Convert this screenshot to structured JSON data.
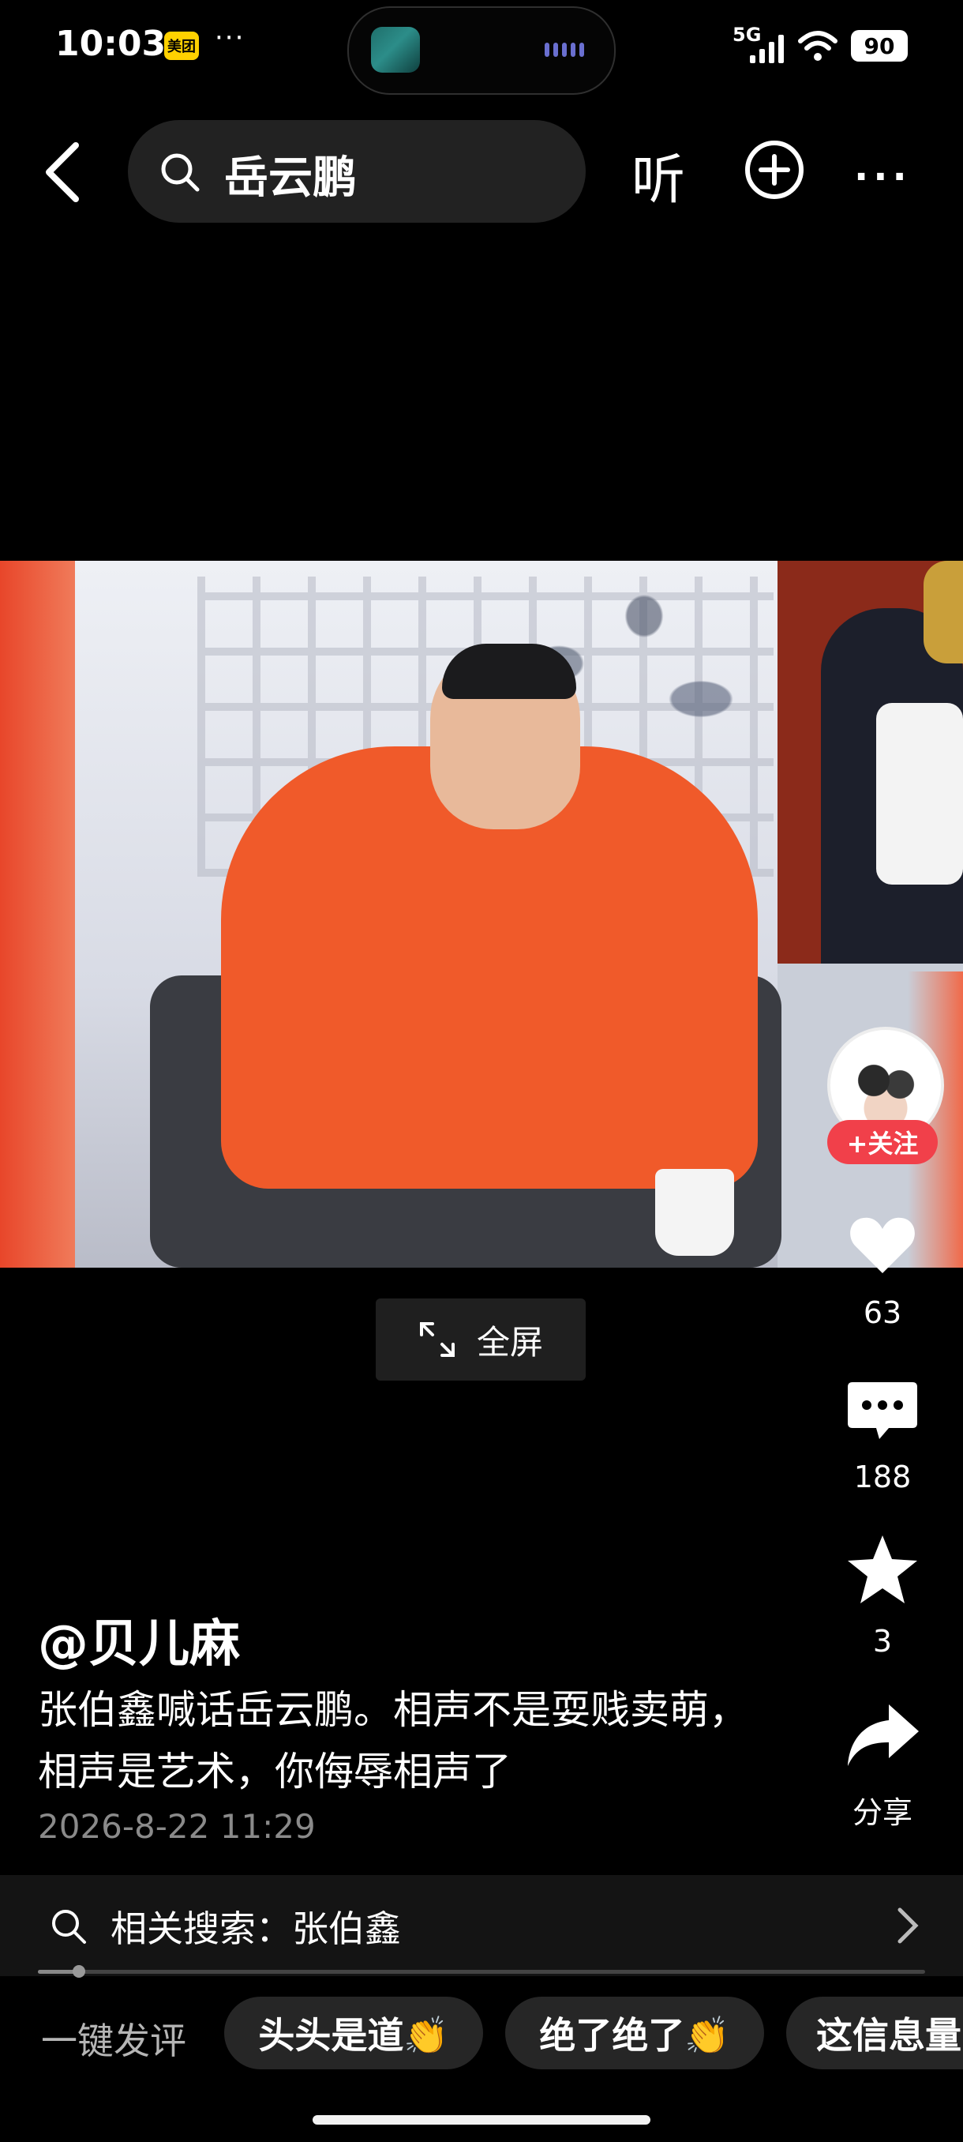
{
  "status_bar": {
    "time": "10:03",
    "app_badge": "美团",
    "more_dots": "···",
    "network": "5G",
    "battery": "90"
  },
  "top_bar": {
    "search_query": "岳云鹏",
    "listen_label": "听"
  },
  "video": {
    "fullscreen_label": "全屏"
  },
  "author_panel": {
    "follow_label": "+关注"
  },
  "actions": {
    "likes": "63",
    "comments": "188",
    "favorites": "3",
    "share_label": "分享"
  },
  "post": {
    "author": "@贝儿麻",
    "caption": "张伯鑫喊话岳云鹏。相声不是耍贱卖萌，相声是艺术，你侮辱相声了",
    "date": "2026-8-22 11:29"
  },
  "related_search": {
    "text": "相关搜索：张伯鑫",
    "progress_fraction": 0.045
  },
  "quick_comments": {
    "label": "一键发评",
    "chips": [
      "头头是道👏",
      "绝了绝了👏",
      "这信息量"
    ]
  },
  "colors": {
    "accent_follow": "#f1404a",
    "background": "#000000"
  }
}
